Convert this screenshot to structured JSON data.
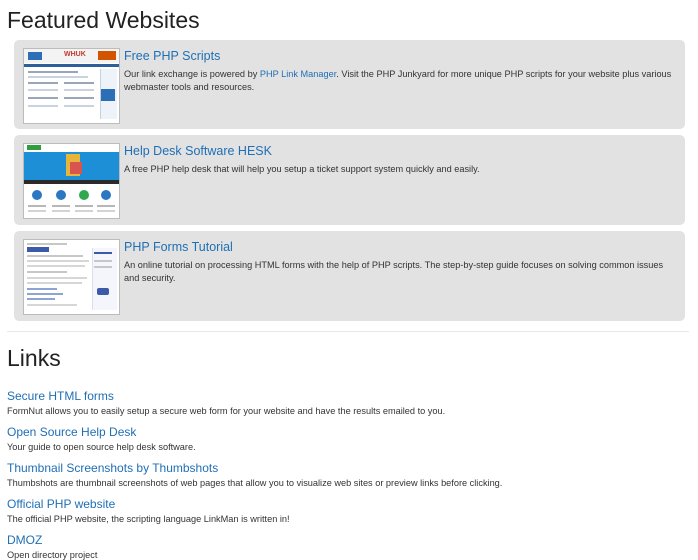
{
  "featured": {
    "title": "Featured Websites",
    "cards": [
      {
        "title": "Free PHP Scripts",
        "desc_before": "Our link exchange is powered by ",
        "desc_link": "PHP Link Manager",
        "desc_after": ". Visit the PHP Junkyard for more unique PHP scripts for your website plus various webmaster tools and resources.",
        "thumb_logo": "WHUK"
      },
      {
        "title": "Help Desk Software HESK",
        "desc": "A free PHP help desk that will help you setup a ticket support system quickly and easily."
      },
      {
        "title": "PHP Forms Tutorial",
        "desc": "An online tutorial on processing HTML forms with the help of PHP scripts. The step-by-step guide focuses on solving common issues and security."
      }
    ]
  },
  "links": {
    "title": "Links",
    "items": [
      {
        "title": "Secure HTML forms",
        "desc": "FormNut allows you to easily setup a secure web form for your website and have the results emailed to you."
      },
      {
        "title": "Open Source Help Desk",
        "desc": "Your guide to open source help desk software."
      },
      {
        "title": "Thumbnail Screenshots by Thumbshots",
        "desc": "Thumbshots are thumbnail screenshots of web pages that allow you to visualize web sites or preview links before clicking."
      },
      {
        "title": "Official PHP website",
        "desc": "The official PHP website, the scripting language LinkMan is written in!"
      },
      {
        "title": "DMOZ",
        "desc": "Open directory project"
      }
    ]
  },
  "colors": {
    "link": "#1f6fb5",
    "card_bg": "#e2e2e2"
  }
}
